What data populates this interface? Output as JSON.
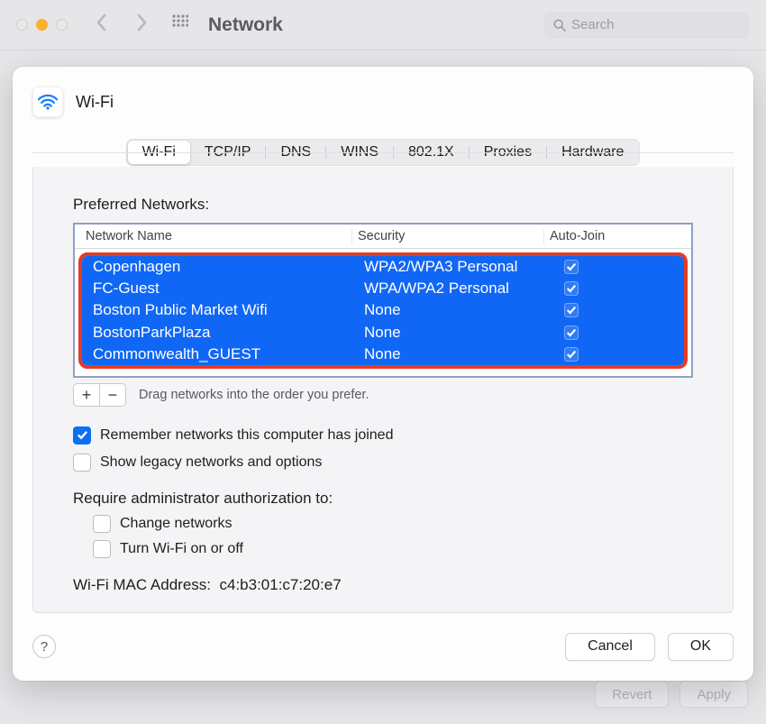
{
  "toolbar": {
    "title": "Network",
    "search_placeholder": "Search"
  },
  "sheet": {
    "title": "Wi-Fi"
  },
  "tabs": {
    "items": [
      "Wi-Fi",
      "TCP/IP",
      "DNS",
      "WINS",
      "802.1X",
      "Proxies",
      "Hardware"
    ],
    "active_index": 0
  },
  "table": {
    "caption": "Preferred Networks:",
    "headers": {
      "name": "Network Name",
      "security": "Security",
      "autojoin": "Auto-Join"
    },
    "rows": [
      {
        "name": "Copenhagen",
        "security": "WPA2/WPA3 Personal",
        "autojoin": true
      },
      {
        "name": "FC-Guest",
        "security": "WPA/WPA2 Personal",
        "autojoin": true
      },
      {
        "name": "Boston Public Market Wifi",
        "security": "None",
        "autojoin": true
      },
      {
        "name": "BostonParkPlaza",
        "security": "None",
        "autojoin": true
      },
      {
        "name": "Commonwealth_GUEST",
        "security": "None",
        "autojoin": true
      }
    ],
    "hint": "Drag networks into the order you prefer."
  },
  "options": {
    "remember": {
      "label": "Remember networks this computer has joined",
      "checked": true
    },
    "legacy": {
      "label": "Show legacy networks and options",
      "checked": false
    },
    "auth_label": "Require administrator authorization to:",
    "change_net": {
      "label": "Change networks",
      "checked": false
    },
    "turn_wifi": {
      "label": "Turn Wi-Fi on or off",
      "checked": false
    }
  },
  "mac": {
    "label": "Wi-Fi MAC Address:",
    "value": "c4:b3:01:c7:20:e7"
  },
  "buttons": {
    "help": "?",
    "cancel": "Cancel",
    "ok": "OK",
    "revert": "Revert",
    "apply": "Apply"
  },
  "colors": {
    "selection_bg": "#1067f5",
    "annotation_border": "#e33b25",
    "accent": "#0a6ff5"
  }
}
